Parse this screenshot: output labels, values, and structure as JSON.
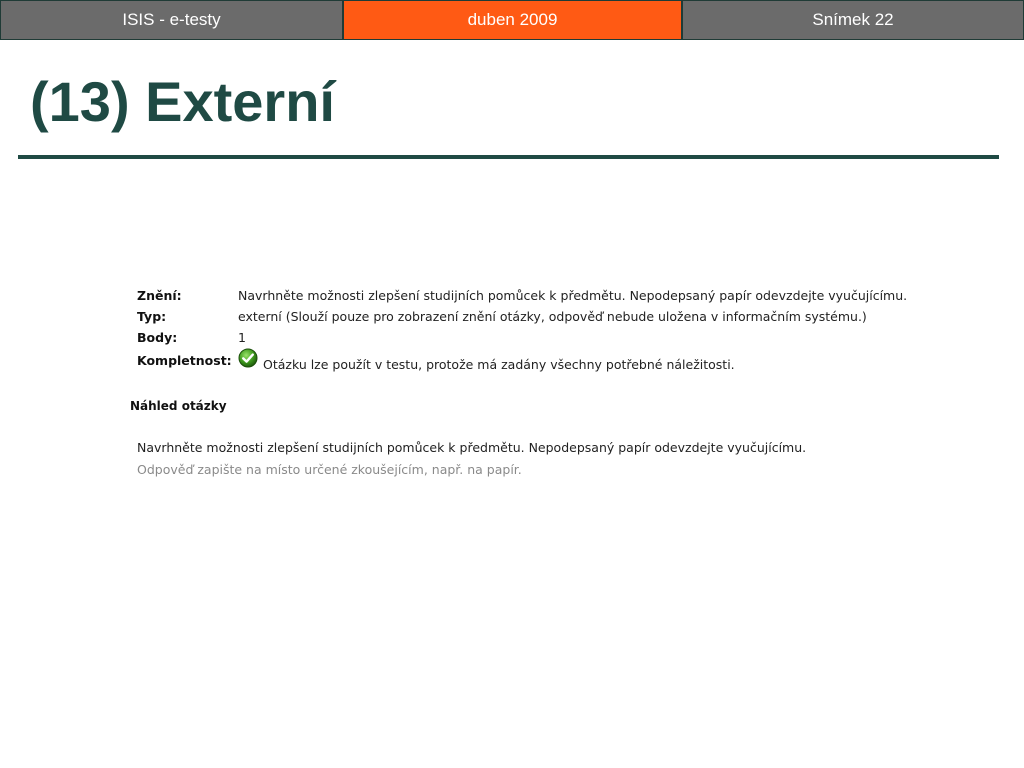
{
  "header": {
    "left": "ISIS - e-testy",
    "middle": "duben 2009",
    "right": "Snímek 22",
    "colors": {
      "side": "#6b6b6b",
      "accent": "#ff5a14"
    }
  },
  "title": "(13) Externí",
  "question_info": {
    "rows": [
      {
        "label": "Znění:",
        "value": "Navrhněte možnosti zlepšení studijních pomůcek k předmětu. Nepodepsaný papír odevzdejte vyučujícímu."
      },
      {
        "label": "Typ:",
        "value": "externí (Slouží pouze pro zobrazení znění otázky, odpověď nebude uložena v informačním systému.)"
      },
      {
        "label": "Body:",
        "value": "1"
      }
    ],
    "completeness": {
      "label": "Kompletnost:",
      "icon": "check-circle-icon",
      "value": "Otázku lze použít v testu, protože má zadány všechny potřebné náležitosti."
    }
  },
  "preview": {
    "heading": "Náhled otázky",
    "question": "Navrhněte možnosti zlepšení studijních pomůcek k předmětu. Nepodepsaný papír odevzdejte vyučujícímu.",
    "hint": "Odpověď zapište na místo určené zkoušejícím, např. na papír."
  }
}
